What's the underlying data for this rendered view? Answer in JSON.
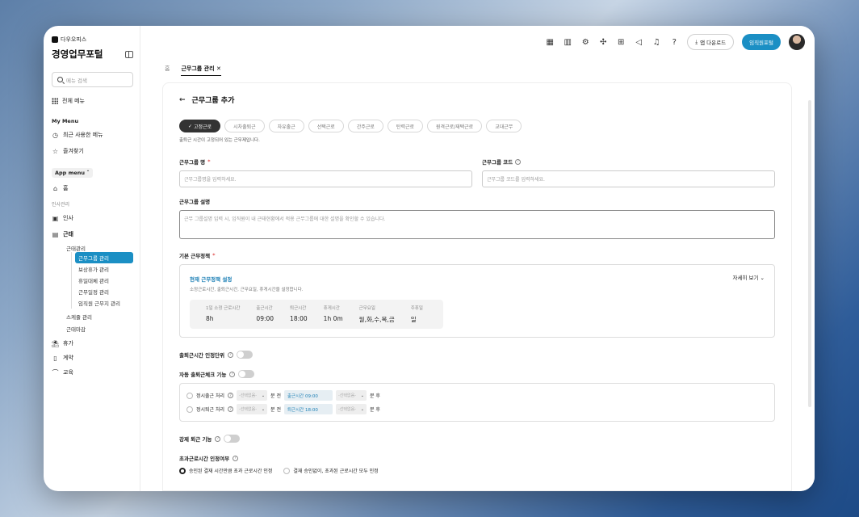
{
  "sidebar": {
    "brand": "다우오피스",
    "app_title": "경영업무포털",
    "search_placeholder": "메뉴 검색",
    "all_menu": "전체 메뉴",
    "my_menu_label": "My Menu",
    "recent_menu": "최근 사용한 메뉴",
    "favorites": "즐겨찾기",
    "app_menu_label": "App menu",
    "home": "홈",
    "hr_section": "인사관리",
    "hr": "인사",
    "attendance": "근태",
    "attendance_mgmt": "근태관리",
    "sub_items": [
      "근무그룹 관리",
      "보상휴가 관리",
      "휴일대체 관리",
      "근무일정 관리",
      "임직원 근무지 관리"
    ],
    "schedule_mgmt": "스케쥴 관리",
    "attendance_close": "근태마감",
    "leave": "휴가",
    "contract": "계약",
    "education": "교육"
  },
  "topbar": {
    "app_download": "앱 다운로드",
    "employee_portal": "임직원포털"
  },
  "tabs": [
    {
      "label": "홈"
    },
    {
      "label": "근무그룹 관리 ✕"
    }
  ],
  "page": {
    "title": "근무그룹 추가",
    "chips": [
      "고정근로",
      "시차출퇴근",
      "자유출근",
      "선택근로",
      "간주근로",
      "탄력근로",
      "원격근로/재택근로",
      "교대근무"
    ],
    "chip_hint": "출퇴근 시간이 고정되어 있는 근무제입니다.",
    "group_name_label": "근무그룹 명",
    "group_name_placeholder": "근무그룹명을 입력하세요.",
    "group_code_label": "근무그룹 코드",
    "group_code_placeholder": "근무그룹 코드를 입력하세요.",
    "desc_label": "근무그룹 설명",
    "desc_placeholder": "근무 그룹설명 입력 시, 임직원이 내 근태현황에서 적용 근무그룹에 대한 설명을 확인할 수 있습니다.",
    "policy_label": "기본 근무정책",
    "policy_title": "현재 근무정책 설정",
    "policy_desc": "소정근로시간, 출퇴근시간, 근무요일, 휴게시간을 설정합니다.",
    "detail_link": "자세히 보기",
    "summary": [
      {
        "k": "1일 소정 근로시간",
        "v": "8h"
      },
      {
        "k": "출근시간",
        "v": "09:00"
      },
      {
        "k": "퇴근시간",
        "v": "18:00"
      },
      {
        "k": "휴게시간",
        "v": "1h 0m"
      },
      {
        "k": "근무요일",
        "v": "월,화,수,목,금"
      },
      {
        "k": "주휴일",
        "v": "일"
      }
    ],
    "checkin_unit_label": "출퇴근시간 인정단위",
    "auto_check_label": "자동 출퇴근체크 기능",
    "auto_in_label": "정시출근 처리",
    "auto_out_label": "정시퇴근 처리",
    "select_placeholder": "-선택없음-",
    "before_label": "분 전",
    "after_label": "분 후",
    "in_time": "출근시간 09:00",
    "out_time": "퇴근시간 18:00",
    "force_out_label": "강제 퇴근 기능",
    "overtime_label": "초과근로시간 인정여부",
    "overtime_opt1": "승인된 결재 시간만큼 초과 근로시간 인정",
    "overtime_opt2": "결재 승인없이, 초과된 근로시간 모두 인정"
  }
}
